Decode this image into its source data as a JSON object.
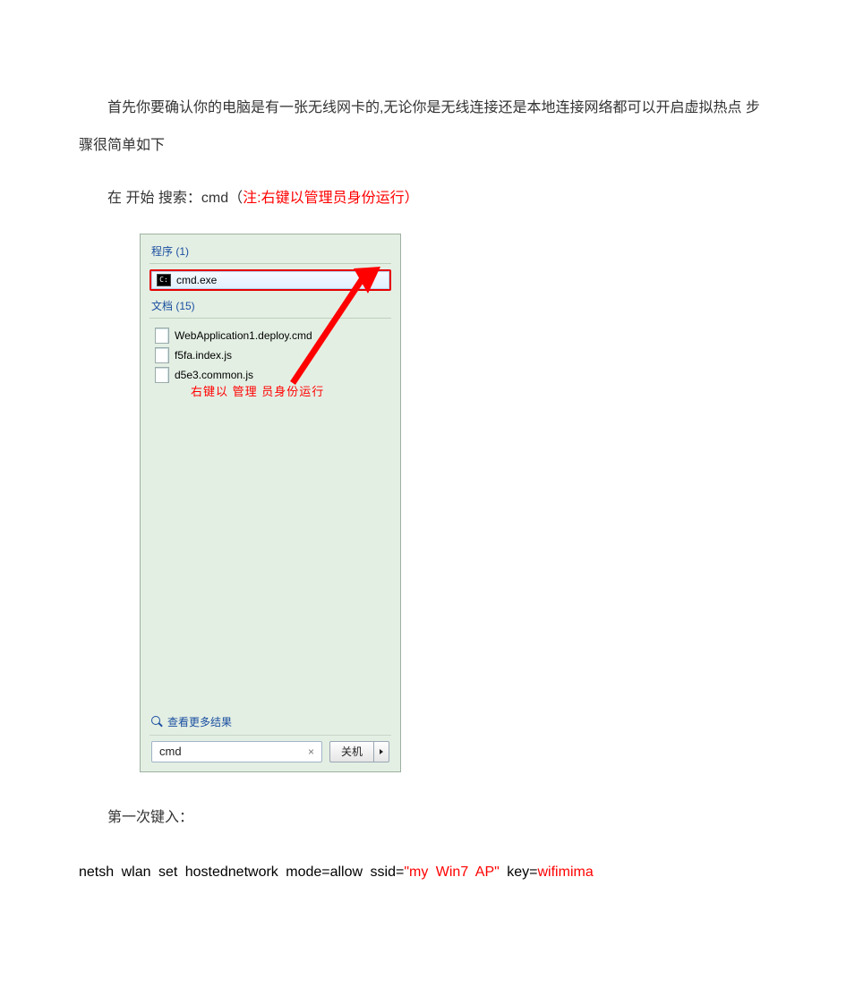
{
  "intro": {
    "p1": "首先你要确认你的电脑是有一张无线网卡的,无论你是无线连接还是本地连接网络都可以开启虚拟热点  步骤很简单如下",
    "p2_prefix": "在  开始  搜索：cmd（",
    "p2_note_label": "注",
    "p2_note_text": ":右键以管理员身份运行",
    "p2_suffix": "）"
  },
  "startmenu": {
    "programs_label": "程序 (1)",
    "programs_item": "cmd.exe",
    "docs_label": "文档 (15)",
    "docs": [
      "WebApplication1.deploy.cmd",
      "f5fa.index.js",
      "d5e3.common.js"
    ],
    "annotation": "右键以 管理 员身份运行",
    "more_results": "查看更多结果",
    "search_value": "cmd",
    "clear_symbol": "×",
    "shutdown_label": "关机"
  },
  "after": {
    "p3": "第一次键入：",
    "cmdline_black_a": "netsh  wlan  set  hostednetwork  mode=allow  ssid=",
    "cmdline_red_a": "\"my  Win7  AP\"",
    "cmdline_black_b": "  key=",
    "cmdline_red_b": "wifimima"
  }
}
